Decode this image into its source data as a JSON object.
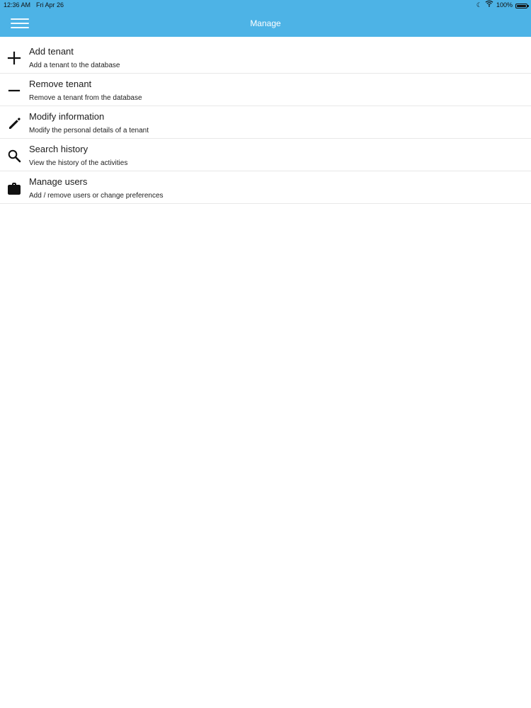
{
  "status": {
    "time": "12:36 AM",
    "date": "Fri Apr 26",
    "moon": "☾",
    "wifi": "wifi-icon",
    "battery_percent": "100%",
    "battery_level": 1.0
  },
  "header": {
    "title": "Manage",
    "menu_icon": "hamburger-menu-icon",
    "background_color": "#4db3e6"
  },
  "menu": {
    "items": [
      {
        "title": "Add tenant",
        "subtitle": "Add a tenant to the database",
        "icon": "plus-icon"
      },
      {
        "title": "Remove tenant",
        "subtitle": "Remove a tenant from the database",
        "icon": "minus-icon"
      },
      {
        "title": "Modify information",
        "subtitle": "Modify the personal details of a tenant",
        "icon": "pencil-icon"
      },
      {
        "title": "Search history",
        "subtitle": "View the history of the activities",
        "icon": "search-icon"
      },
      {
        "title": "Manage users",
        "subtitle": "Add / remove users or change preferences",
        "icon": "briefcase-icon"
      }
    ]
  }
}
